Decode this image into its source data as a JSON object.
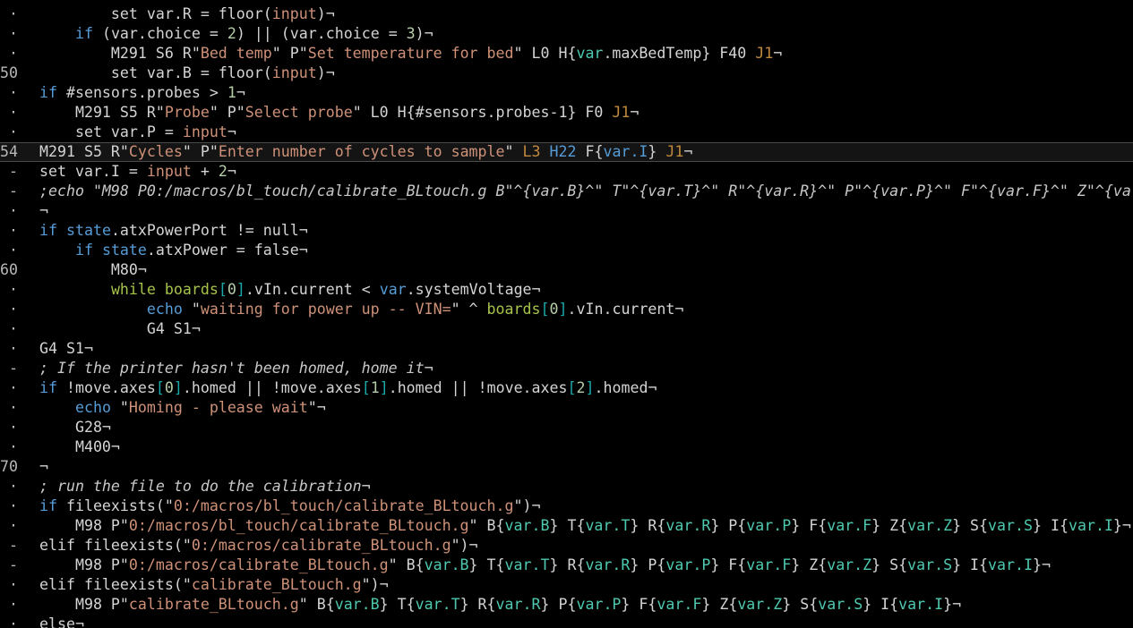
{
  "editor": {
    "colors": {
      "background": "#000000",
      "text": "#d4d4d4",
      "keyword": "#569cd6",
      "string": "#ce9178",
      "number": "#b5cea8",
      "variable": "#4ec9b0",
      "object": "#a6c34a",
      "bracket": "#1ba8a8",
      "comment": "#c8c8c8",
      "dim": "#bf8a3c",
      "gutter": "#b8b8b8"
    },
    "current_line_index": 7,
    "lines": [
      {
        "gutter": "·",
        "tokens": [
          {
            "t": "        set var.R = floor(",
            "c": "text"
          },
          {
            "t": "input",
            "c": "string"
          },
          {
            "t": ")¬",
            "c": "text"
          }
        ]
      },
      {
        "gutter": "·",
        "tokens": [
          {
            "t": "    ",
            "c": "text"
          },
          {
            "t": "if",
            "c": "keyword"
          },
          {
            "t": " (",
            "c": "text"
          },
          {
            "t": "var",
            "c": "text"
          },
          {
            "t": ".choice = ",
            "c": "text"
          },
          {
            "t": "2",
            "c": "number"
          },
          {
            "t": ") || (",
            "c": "text"
          },
          {
            "t": "var",
            "c": "text"
          },
          {
            "t": ".choice = ",
            "c": "text"
          },
          {
            "t": "3",
            "c": "number"
          },
          {
            "t": ")¬",
            "c": "text"
          }
        ]
      },
      {
        "gutter": "·",
        "tokens": [
          {
            "t": "        M291 S6 R\"",
            "c": "text"
          },
          {
            "t": "Bed temp",
            "c": "string"
          },
          {
            "t": "\" P\"",
            "c": "text"
          },
          {
            "t": "Set temperature for bed",
            "c": "string"
          },
          {
            "t": "\" L0 H{",
            "c": "text"
          },
          {
            "t": "var",
            "c": "variable"
          },
          {
            "t": ".maxBedTemp} F40 ",
            "c": "text"
          },
          {
            "t": "J1",
            "c": "dim"
          },
          {
            "t": "¬",
            "c": "text"
          }
        ]
      },
      {
        "gutter": "50",
        "tokens": [
          {
            "t": "        set var.B = floor(",
            "c": "text"
          },
          {
            "t": "input",
            "c": "string"
          },
          {
            "t": ")¬",
            "c": "text"
          }
        ]
      },
      {
        "gutter": "·",
        "tokens": [
          {
            "t": "if",
            "c": "keyword"
          },
          {
            "t": " #sensors.probes > ",
            "c": "text"
          },
          {
            "t": "1",
            "c": "number"
          },
          {
            "t": "¬",
            "c": "text"
          }
        ]
      },
      {
        "gutter": "·",
        "tokens": [
          {
            "t": "    M291 S5 R\"",
            "c": "text"
          },
          {
            "t": "Probe",
            "c": "string"
          },
          {
            "t": "\" P\"",
            "c": "text"
          },
          {
            "t": "Select probe",
            "c": "string"
          },
          {
            "t": "\" L0 H{#sensors.probes-1} F0 ",
            "c": "text"
          },
          {
            "t": "J1",
            "c": "dim"
          },
          {
            "t": "¬",
            "c": "text"
          }
        ]
      },
      {
        "gutter": "·",
        "tokens": [
          {
            "t": "    set var.P = ",
            "c": "text"
          },
          {
            "t": "input",
            "c": "string"
          },
          {
            "t": "¬",
            "c": "text"
          }
        ]
      },
      {
        "gutter": "54",
        "tokens": [
          {
            "t": "M291 S5 R\"",
            "c": "text"
          },
          {
            "t": "Cycles",
            "c": "string"
          },
          {
            "t": "\" P\"",
            "c": "text"
          },
          {
            "t": "Enter number of cycles to sample",
            "c": "string"
          },
          {
            "t": "\" ",
            "c": "text"
          },
          {
            "t": "L3",
            "c": "dim"
          },
          {
            "t": " ",
            "c": "text"
          },
          {
            "t": "H22",
            "c": "keyword"
          },
          {
            "t": " F{",
            "c": "text"
          },
          {
            "t": "var.I",
            "c": "keyword"
          },
          {
            "t": "} ",
            "c": "text"
          },
          {
            "t": "J1",
            "c": "dim"
          },
          {
            "t": "¬",
            "c": "text"
          }
        ]
      },
      {
        "gutter": "-",
        "tokens": [
          {
            "t": "set var.I = ",
            "c": "text"
          },
          {
            "t": "input",
            "c": "string"
          },
          {
            "t": " + ",
            "c": "text"
          },
          {
            "t": "2",
            "c": "number"
          },
          {
            "t": "¬",
            "c": "text"
          }
        ]
      },
      {
        "gutter": "-",
        "tokens": [
          {
            "t": ";echo \"M98 P0:/macros/bl_touch/calibrate_BLtouch.g B\"^{var.B}^\" T\"^{var.T}^\" R\"^{var.R}^\" P\"^{var.P}^\" F\"^{var.F}^\" Z\"^{va",
            "c": "comment"
          }
        ]
      },
      {
        "gutter": "·",
        "tokens": [
          {
            "t": "¬",
            "c": "text"
          }
        ]
      },
      {
        "gutter": "·",
        "tokens": [
          {
            "t": "if",
            "c": "keyword"
          },
          {
            "t": " ",
            "c": "text"
          },
          {
            "t": "state",
            "c": "keyword"
          },
          {
            "t": ".atxPowerPort != null¬",
            "c": "text"
          }
        ]
      },
      {
        "gutter": "·",
        "tokens": [
          {
            "t": "    ",
            "c": "text"
          },
          {
            "t": "if",
            "c": "keyword"
          },
          {
            "t": " ",
            "c": "text"
          },
          {
            "t": "state",
            "c": "keyword"
          },
          {
            "t": ".atxPower = false¬",
            "c": "text"
          }
        ]
      },
      {
        "gutter": "60",
        "tokens": [
          {
            "t": "        M80¬",
            "c": "text"
          }
        ]
      },
      {
        "gutter": "·",
        "tokens": [
          {
            "t": "        ",
            "c": "text"
          },
          {
            "t": "while",
            "c": "object"
          },
          {
            "t": " ",
            "c": "text"
          },
          {
            "t": "boards",
            "c": "object"
          },
          {
            "t": "[",
            "c": "bracket"
          },
          {
            "t": "0",
            "c": "number"
          },
          {
            "t": "]",
            "c": "bracket"
          },
          {
            "t": ".vIn.current < ",
            "c": "text"
          },
          {
            "t": "var",
            "c": "keyword"
          },
          {
            "t": ".systemVoltage¬",
            "c": "text"
          }
        ]
      },
      {
        "gutter": "·",
        "tokens": [
          {
            "t": "            ",
            "c": "text"
          },
          {
            "t": "echo",
            "c": "keyword"
          },
          {
            "t": " \"",
            "c": "text"
          },
          {
            "t": "waiting for power up -- VIN=",
            "c": "string"
          },
          {
            "t": "\" ^ ",
            "c": "text"
          },
          {
            "t": "boards",
            "c": "object"
          },
          {
            "t": "[",
            "c": "bracket"
          },
          {
            "t": "0",
            "c": "number"
          },
          {
            "t": "]",
            "c": "bracket"
          },
          {
            "t": ".vIn.current¬",
            "c": "text"
          }
        ]
      },
      {
        "gutter": "·",
        "tokens": [
          {
            "t": "            G4 S1¬",
            "c": "text"
          }
        ]
      },
      {
        "gutter": "·",
        "tokens": [
          {
            "t": "G4 S1¬",
            "c": "text"
          }
        ]
      },
      {
        "gutter": "-",
        "tokens": [
          {
            "t": "; If the printer hasn't been homed, home it",
            "c": "comment"
          },
          {
            "t": "¬",
            "c": "text"
          }
        ]
      },
      {
        "gutter": "·",
        "tokens": [
          {
            "t": "if",
            "c": "keyword"
          },
          {
            "t": " !move.axes",
            "c": "text"
          },
          {
            "t": "[",
            "c": "bracket"
          },
          {
            "t": "0",
            "c": "number"
          },
          {
            "t": "]",
            "c": "bracket"
          },
          {
            "t": ".homed || !move.axes",
            "c": "text"
          },
          {
            "t": "[",
            "c": "bracket"
          },
          {
            "t": "1",
            "c": "number"
          },
          {
            "t": "]",
            "c": "bracket"
          },
          {
            "t": ".homed || !move.axes",
            "c": "text"
          },
          {
            "t": "[",
            "c": "bracket"
          },
          {
            "t": "2",
            "c": "number"
          },
          {
            "t": "]",
            "c": "bracket"
          },
          {
            "t": ".homed¬",
            "c": "text"
          }
        ]
      },
      {
        "gutter": "·",
        "tokens": [
          {
            "t": "    ",
            "c": "text"
          },
          {
            "t": "echo",
            "c": "keyword"
          },
          {
            "t": " \"",
            "c": "text"
          },
          {
            "t": "Homing - please wait",
            "c": "string"
          },
          {
            "t": "\"¬",
            "c": "text"
          }
        ]
      },
      {
        "gutter": "·",
        "tokens": [
          {
            "t": "    G28¬",
            "c": "text"
          }
        ]
      },
      {
        "gutter": "·",
        "tokens": [
          {
            "t": "    M400¬",
            "c": "text"
          }
        ]
      },
      {
        "gutter": "70",
        "tokens": [
          {
            "t": "¬",
            "c": "text"
          }
        ]
      },
      {
        "gutter": "·",
        "tokens": [
          {
            "t": "; run the file to do the calibration",
            "c": "comment"
          },
          {
            "t": "¬",
            "c": "text"
          }
        ]
      },
      {
        "gutter": "·",
        "tokens": [
          {
            "t": "if",
            "c": "keyword"
          },
          {
            "t": " fileexists(\"",
            "c": "text"
          },
          {
            "t": "0:/macros/bl_touch/calibrate_BLtouch.g",
            "c": "string"
          },
          {
            "t": "\")¬",
            "c": "text"
          }
        ]
      },
      {
        "gutter": "·",
        "tokens": [
          {
            "t": "    M98 P\"",
            "c": "text"
          },
          {
            "t": "0:/macros/bl_touch/calibrate_BLtouch.g",
            "c": "string"
          },
          {
            "t": "\" B{",
            "c": "text"
          },
          {
            "t": "var.B",
            "c": "variable"
          },
          {
            "t": "} T{",
            "c": "text"
          },
          {
            "t": "var.T",
            "c": "variable"
          },
          {
            "t": "} R{",
            "c": "text"
          },
          {
            "t": "var.R",
            "c": "variable"
          },
          {
            "t": "} P{",
            "c": "text"
          },
          {
            "t": "var.P",
            "c": "variable"
          },
          {
            "t": "} F{",
            "c": "text"
          },
          {
            "t": "var.F",
            "c": "variable"
          },
          {
            "t": "} Z{",
            "c": "text"
          },
          {
            "t": "var.Z",
            "c": "variable"
          },
          {
            "t": "} S{",
            "c": "text"
          },
          {
            "t": "var.S",
            "c": "variable"
          },
          {
            "t": "} I{",
            "c": "text"
          },
          {
            "t": "var.I",
            "c": "variable"
          },
          {
            "t": "}¬",
            "c": "text"
          }
        ]
      },
      {
        "gutter": "-",
        "tokens": [
          {
            "t": "elif fileexists(\"",
            "c": "text"
          },
          {
            "t": "0:/macros/calibrate_BLtouch.g",
            "c": "string"
          },
          {
            "t": "\")¬",
            "c": "text"
          }
        ]
      },
      {
        "gutter": "-",
        "tokens": [
          {
            "t": "    M98 P\"",
            "c": "text"
          },
          {
            "t": "0:/macros/calibrate_BLtouch.g",
            "c": "string"
          },
          {
            "t": "\" B{",
            "c": "text"
          },
          {
            "t": "var.B",
            "c": "variable"
          },
          {
            "t": "} T{",
            "c": "text"
          },
          {
            "t": "var.T",
            "c": "variable"
          },
          {
            "t": "} R{",
            "c": "text"
          },
          {
            "t": "var.R",
            "c": "variable"
          },
          {
            "t": "} P{",
            "c": "text"
          },
          {
            "t": "var.P",
            "c": "variable"
          },
          {
            "t": "} F{",
            "c": "text"
          },
          {
            "t": "var.F",
            "c": "variable"
          },
          {
            "t": "} Z{",
            "c": "text"
          },
          {
            "t": "var.Z",
            "c": "variable"
          },
          {
            "t": "} S{",
            "c": "text"
          },
          {
            "t": "var.S",
            "c": "variable"
          },
          {
            "t": "} I{",
            "c": "text"
          },
          {
            "t": "var.I",
            "c": "variable"
          },
          {
            "t": "}¬",
            "c": "text"
          }
        ]
      },
      {
        "gutter": "·",
        "tokens": [
          {
            "t": "elif fileexists(\"",
            "c": "text"
          },
          {
            "t": "calibrate_BLtouch.g",
            "c": "string"
          },
          {
            "t": "\")¬",
            "c": "text"
          }
        ]
      },
      {
        "gutter": "·",
        "tokens": [
          {
            "t": "    M98 P\"",
            "c": "text"
          },
          {
            "t": "calibrate_BLtouch.g",
            "c": "string"
          },
          {
            "t": "\" B{",
            "c": "text"
          },
          {
            "t": "var.B",
            "c": "variable"
          },
          {
            "t": "} T{",
            "c": "text"
          },
          {
            "t": "var.T",
            "c": "variable"
          },
          {
            "t": "} R{",
            "c": "text"
          },
          {
            "t": "var.R",
            "c": "variable"
          },
          {
            "t": "} P{",
            "c": "text"
          },
          {
            "t": "var.P",
            "c": "variable"
          },
          {
            "t": "} F{",
            "c": "text"
          },
          {
            "t": "var.F",
            "c": "variable"
          },
          {
            "t": "} Z{",
            "c": "text"
          },
          {
            "t": "var.Z",
            "c": "variable"
          },
          {
            "t": "} S{",
            "c": "text"
          },
          {
            "t": "var.S",
            "c": "variable"
          },
          {
            "t": "} I{",
            "c": "text"
          },
          {
            "t": "var.I",
            "c": "variable"
          },
          {
            "t": "}¬",
            "c": "text"
          }
        ]
      },
      {
        "gutter": "·",
        "tokens": [
          {
            "t": "else¬",
            "c": "text"
          }
        ]
      }
    ]
  }
}
